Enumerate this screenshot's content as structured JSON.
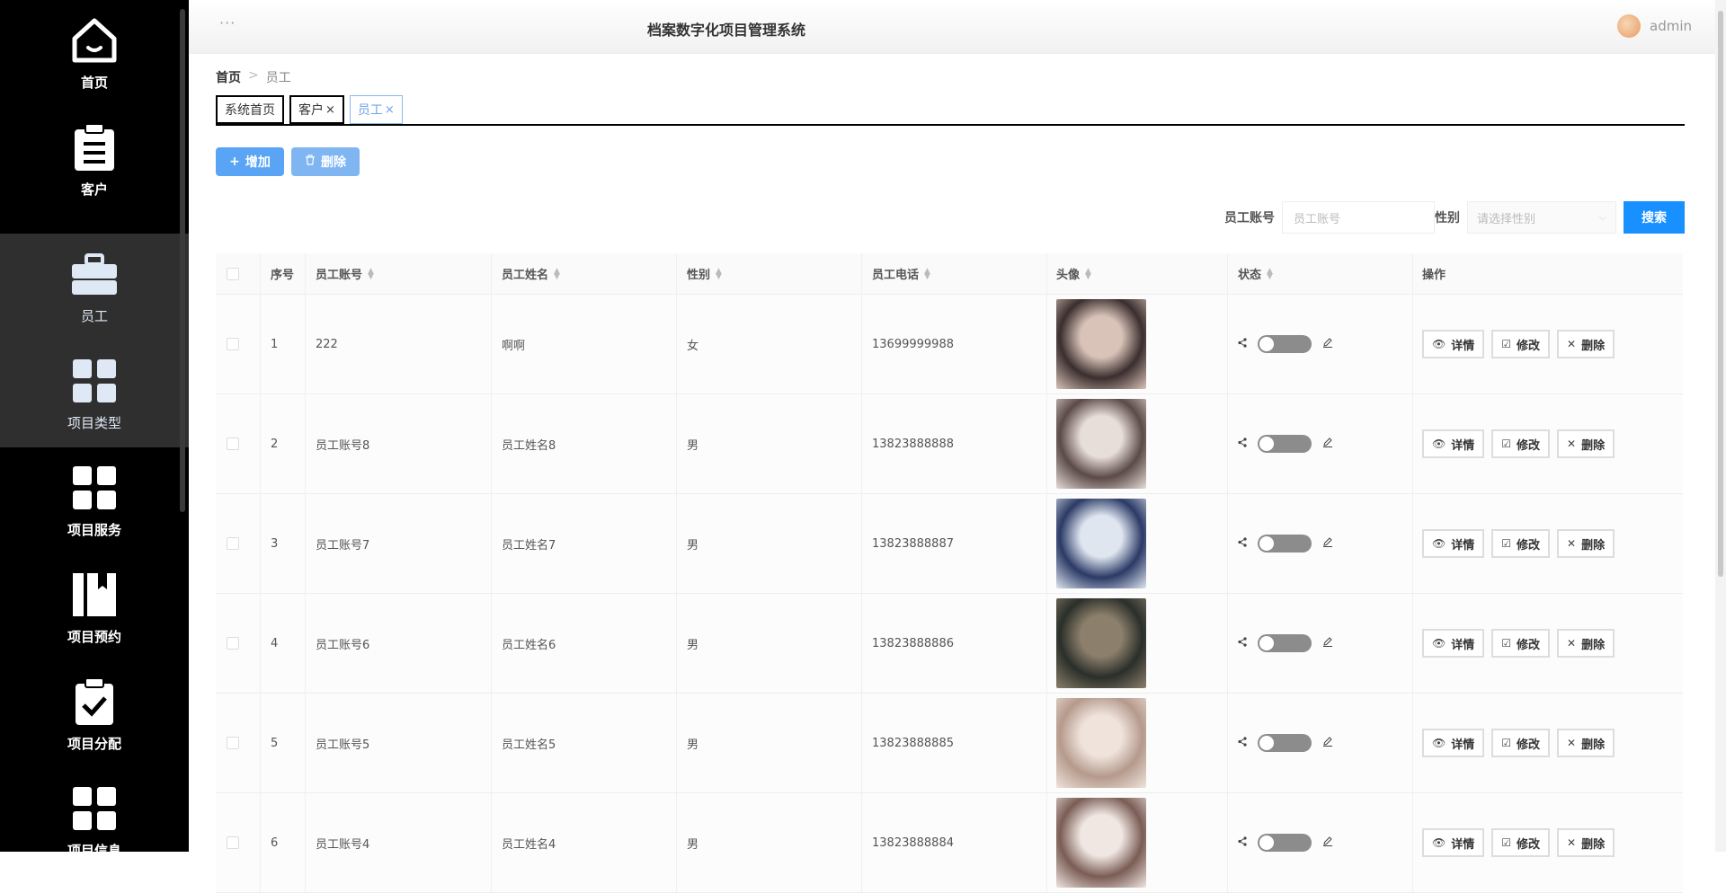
{
  "app": {
    "title": "档案数字化项目管理系统",
    "dots": "···",
    "user": "admin"
  },
  "sidebar": {
    "items": [
      {
        "label": "首页",
        "icon": "home-icon"
      },
      {
        "label": "客户",
        "icon": "clipboard-icon"
      },
      {
        "label": "员工",
        "icon": "briefcase-icon"
      },
      {
        "label": "项目类型",
        "icon": "grid-icon"
      },
      {
        "label": "项目服务",
        "icon": "grid-icon"
      },
      {
        "label": "项目预约",
        "icon": "book-icon"
      },
      {
        "label": "项目分配",
        "icon": "checklist-icon"
      },
      {
        "label": "项目信息",
        "icon": "grid-icon"
      }
    ]
  },
  "breadcrumb": {
    "home": "首页",
    "sep": ">",
    "current": "员工"
  },
  "tabs": [
    {
      "label": "系统首页",
      "close": ""
    },
    {
      "label": "客户",
      "close": "×"
    },
    {
      "label": "员工",
      "close": "×"
    }
  ],
  "actions": {
    "add": "增加",
    "delete": "删除",
    "add_icon": "+",
    "delete_icon": "🗑"
  },
  "search": {
    "account_label": "员工账号",
    "account_placeholder": "员工账号",
    "gender_label": "性别",
    "gender_placeholder": "请选择性别",
    "button": "搜索"
  },
  "table": {
    "headers": {
      "index": "序号",
      "account": "员工账号",
      "name": "员工姓名",
      "gender": "性别",
      "phone": "员工电话",
      "avatar": "头像",
      "status": "状态",
      "ops": "操作"
    },
    "rows": [
      {
        "index": "1",
        "account": "222",
        "name": "啊啊",
        "gender": "女",
        "phone": "13699999988",
        "photo_colors": [
          "#d9c3b8",
          "#3a2e2e"
        ]
      },
      {
        "index": "2",
        "account": "员工账号8",
        "name": "员工姓名8",
        "gender": "男",
        "phone": "13823888888",
        "photo_colors": [
          "#e7ddd9",
          "#5b4a48"
        ]
      },
      {
        "index": "3",
        "account": "员工账号7",
        "name": "员工姓名7",
        "gender": "男",
        "phone": "13823888887",
        "photo_colors": [
          "#dfe6f0",
          "#2b3a66"
        ]
      },
      {
        "index": "4",
        "account": "员工账号6",
        "name": "员工姓名6",
        "gender": "男",
        "phone": "13823888886",
        "photo_colors": [
          "#8c7f6b",
          "#2a2f2a"
        ]
      },
      {
        "index": "5",
        "account": "员工账号5",
        "name": "员工姓名5",
        "gender": "男",
        "phone": "13823888885",
        "photo_colors": [
          "#efe3dc",
          "#b59a8c"
        ]
      },
      {
        "index": "6",
        "account": "员工账号4",
        "name": "员工姓名4",
        "gender": "男",
        "phone": "13823888884",
        "photo_colors": [
          "#f0e6e2",
          "#7a5d55"
        ]
      }
    ],
    "op_labels": {
      "detail": "详情",
      "edit": "修改",
      "delete": "删除"
    }
  }
}
